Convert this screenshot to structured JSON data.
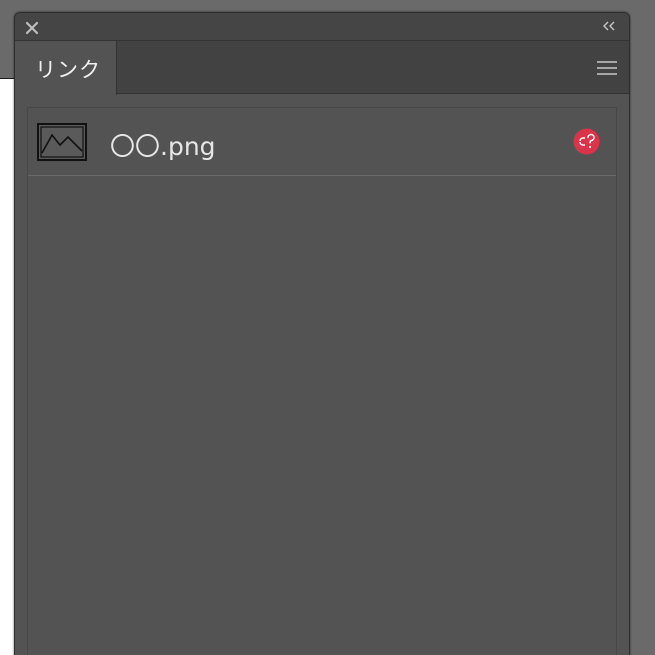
{
  "panel": {
    "tab_label": "リンク",
    "controls": {
      "close_icon": "close-icon",
      "collapse_icon": "double-chevron-left-icon",
      "menu_icon": "hamburger-menu-icon"
    }
  },
  "links": [
    {
      "file_name": "〇〇.png",
      "thumbnail_icon": "image-thumbnail-icon",
      "status": "missing",
      "status_icon": "missing-link-icon",
      "status_color": "#d9344a"
    }
  ],
  "colors": {
    "panel_bg": "#535353",
    "title_bar_bg": "#454545",
    "tab_row_bg": "#424242",
    "text": "#e6e6e6",
    "missing_badge": "#d9344a"
  }
}
